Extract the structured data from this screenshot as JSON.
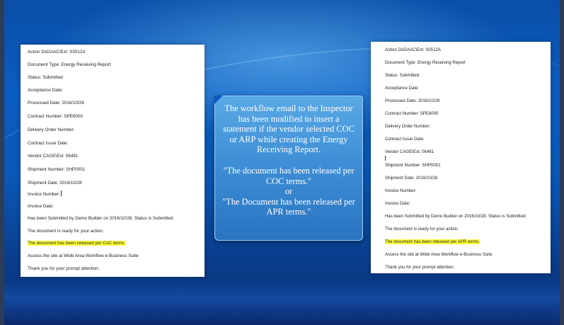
{
  "left_document": {
    "lines": [
      "Action DoDAAC\\Ext: S0512A",
      "Document Type: Energy Receiving Report",
      "Status: Submitted",
      "Acceptance Date:",
      "Processed Date: 2016/10/28",
      "Contract Number: SPE6000",
      "Delivery Order Number:",
      "Contract Issue Date:",
      "Vendor CAGE\\Ext: 06481",
      "Shipment Number: SHP0001",
      "Shipment Date: 2016/10/28",
      "Invoice Number:",
      "Invoice Date:",
      "Has been Submitted by Demo Builder on 2016/10/28. Status is Submitted.",
      "The document is ready for your action.",
      "The document has been released per CoC terms.",
      "Access the site at Wide Area Workflow e-Business Suite",
      "Thank you for your prompt attention."
    ]
  },
  "right_document": {
    "lines": [
      "Action DoDAAC\\Ext: S0512A",
      "Document Type: Energy Receiving Report",
      "Status: Submitted",
      "Acceptance Date:",
      "Processed Date: 2016/10/28",
      "Contract Number: SPE6000",
      "Delivery Order Number:",
      "Contract Issue Date:",
      "Vendor CAGE\\Ext: 06481",
      "Shipment Number: SHP0001",
      "Shipment Date: 2016/10/28",
      "Invoice Number:",
      "Invoice Date:",
      "Has been Submitted by Demo Builder on 2016/10/28. Status is Submitted.",
      "The document is ready for your action.",
      "The document has been released per APR terms.",
      "Access the site at Wide Area Workflow e-Business Suite",
      "Thank you for your prompt attention."
    ]
  },
  "callout": {
    "intro": "The workflow email to the Inspector has been modified to insert a statement if the vendor selected COC or ARP while creating the Energy Receiving Report.",
    "quote_coc": "\"The document has been released per COC terms.\"",
    "or": "or",
    "quote_apr": "\"The Document has been released per APR terms.\""
  },
  "colors": {
    "background": "#0b5cc0",
    "highlight": "#ffff3a",
    "callout_fill": "#3f8fd6",
    "callout_text": "#ffffff"
  }
}
